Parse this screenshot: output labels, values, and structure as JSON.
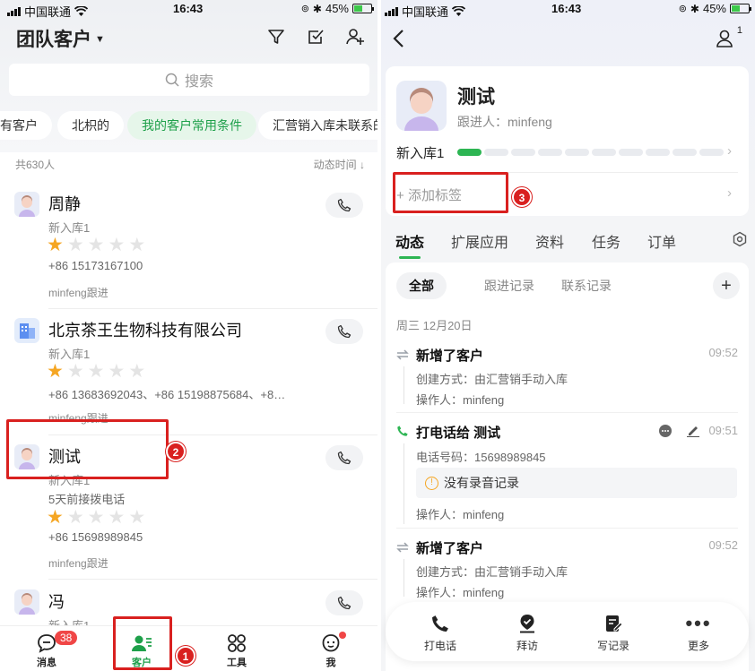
{
  "status_left": {
    "carrier": "中国联通",
    "time": "16:43",
    "battery": "45%"
  },
  "status_right": {
    "carrier": "中国联通",
    "time": "16:43",
    "battery": "45%"
  },
  "left": {
    "title": "团队客户",
    "search_placeholder": "搜索",
    "chips": [
      "有客户",
      "北枳的",
      "我的客户常用条件",
      "汇营销入库未联系的"
    ],
    "active_chip": 2,
    "count": "共630人",
    "sort_label": "动态时间",
    "customers": [
      {
        "name": "周静",
        "stage": "新入库1",
        "rating": 1,
        "phone": "+86 15173167100",
        "follow": "minfeng跟进"
      },
      {
        "name": "北京茶王生物科技有限公司",
        "stage": "新入库1",
        "rating": 1,
        "phone": "+86 13683692043、+86 15198875684、+8…",
        "follow": "minfeng跟进"
      },
      {
        "name": "测试",
        "stage": "新入库1",
        "note": "5天前接拨电话",
        "rating": 1,
        "phone": "+86 15698989845",
        "follow": "minfeng跟进"
      },
      {
        "name": "冯",
        "stage": "新入库1"
      }
    ],
    "tabbar": [
      {
        "label": "消息",
        "icon": "message-icon"
      },
      {
        "label": "客户",
        "icon": "customer-icon"
      },
      {
        "label": "工具",
        "icon": "tools-icon"
      },
      {
        "label": "我",
        "icon": "me-icon"
      }
    ],
    "message_badge": "38",
    "active_tab": 1
  },
  "annotations": {
    "n1": "1",
    "n2": "2",
    "n3": "3"
  },
  "right": {
    "user_badge": "1",
    "customer": {
      "name": "测试",
      "follow_label": "跟进人：minfeng",
      "stage": "新入库1",
      "progress_steps_done": 1,
      "progress_steps_total": 10
    },
    "add_tag": "添加标签",
    "tabs": [
      "动态",
      "扩展应用",
      "资料",
      "任务",
      "订单"
    ],
    "active_tab": 0,
    "filters": [
      "全部",
      "跟进记录",
      "联系记录"
    ],
    "date_header": "周三 12月20日",
    "events": [
      {
        "title": "新增了客户",
        "time": "09:52",
        "lines": [
          "创建方式：由汇营销手动入库",
          "操作人：minfeng"
        ]
      },
      {
        "title": "打电话给 测试",
        "time": "09:51",
        "phone": "电话号码：15698989845",
        "no_record": "没有录音记录",
        "operator": "操作人：minfeng"
      },
      {
        "title": "新增了客户",
        "time": "09:52",
        "lines": [
          "创建方式：由汇营销手动入库",
          "操作人：minfeng"
        ]
      }
    ],
    "actions": [
      {
        "label": "打电话",
        "icon": "phone-icon"
      },
      {
        "label": "拜访",
        "icon": "visit-icon"
      },
      {
        "label": "写记录",
        "icon": "write-record-icon"
      },
      {
        "label": "更多",
        "icon": "more-icon"
      }
    ]
  },
  "colors": {
    "accent": "#2db553",
    "annotation": "#d9201f",
    "star": "#f5a623"
  }
}
